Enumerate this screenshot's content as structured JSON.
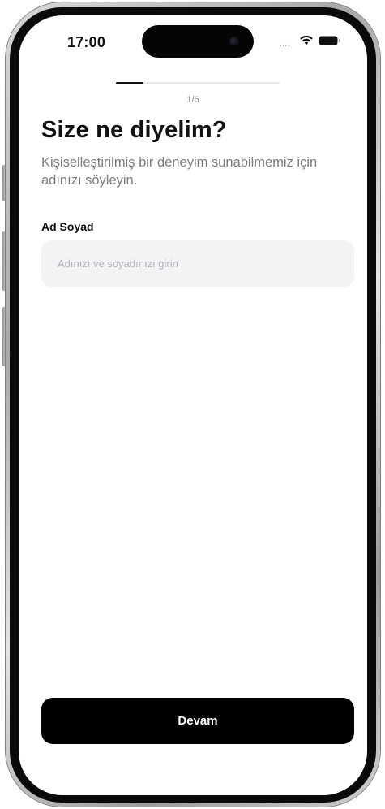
{
  "status_bar": {
    "time": "17:00",
    "signal_dots": "....",
    "icons": [
      "wifi-icon",
      "battery-icon"
    ]
  },
  "progress": {
    "text": "1/6",
    "current_step": 1,
    "total_steps": 6,
    "fraction": 0.1667
  },
  "title": "Size ne diyelim?",
  "subtitle": "Kişiselleştirilmiş bir deneyim sunabilmemiz için adınızı söyleyin.",
  "form": {
    "label": "Ad Soyad",
    "value": "",
    "placeholder": "Adınızı ve soyadınızı girin"
  },
  "continue_button": {
    "label": "Devam"
  },
  "colors": {
    "accent": "#000000",
    "input_bg": "#f3f3f5",
    "subtitle": "#7d7d7d"
  }
}
